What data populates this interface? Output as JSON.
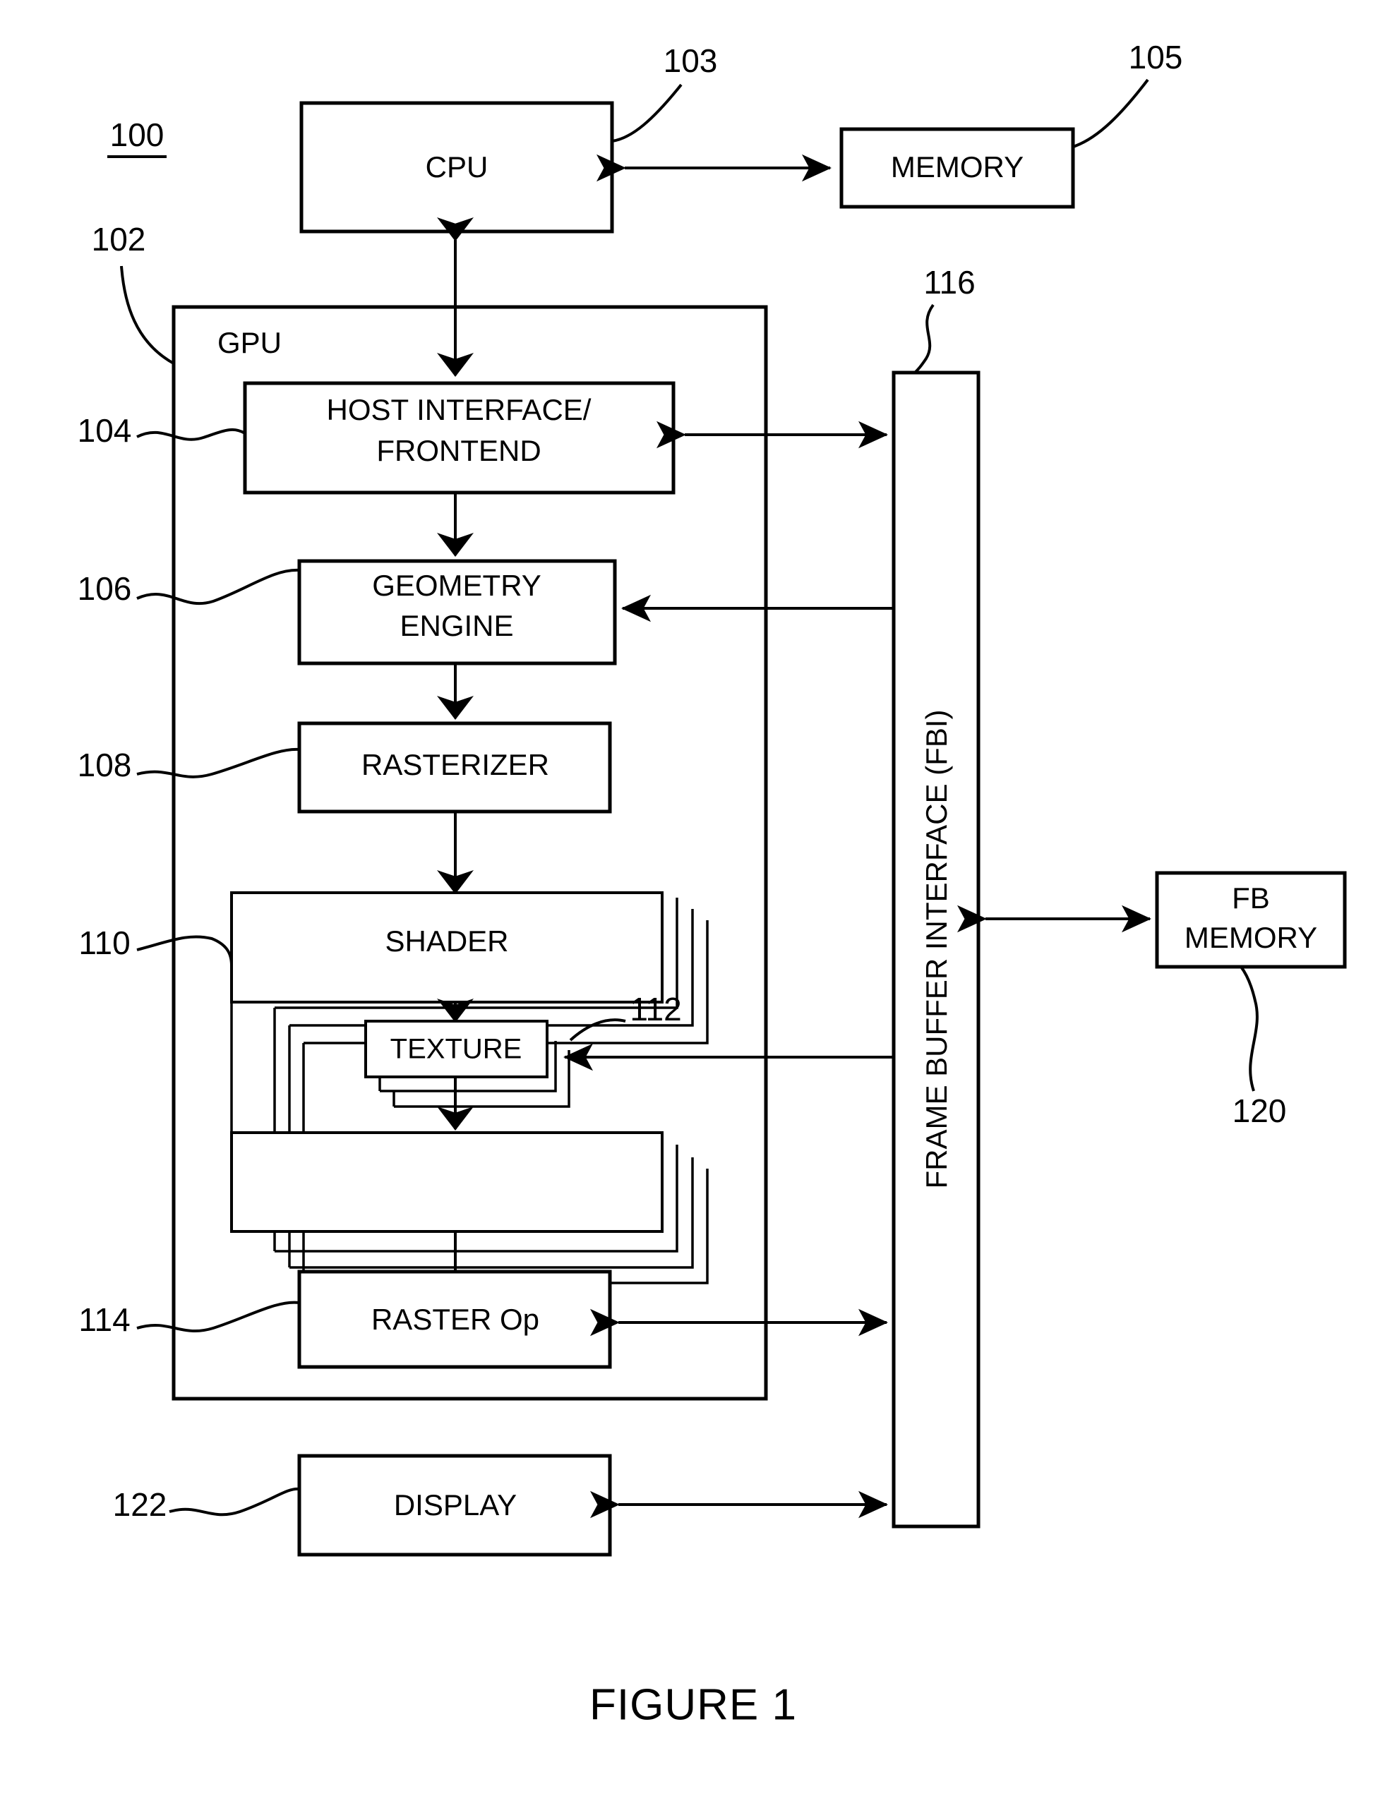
{
  "figure": {
    "caption": "FIGURE 1",
    "system_ref": "100"
  },
  "blocks": {
    "cpu": {
      "label": "CPU",
      "ref": "103"
    },
    "memory": {
      "label": "MEMORY",
      "ref": "105"
    },
    "gpu": {
      "label": "GPU",
      "ref": "102"
    },
    "host_interface": {
      "label_line1": "HOST INTERFACE/",
      "label_line2": "FRONTEND",
      "ref": "104"
    },
    "geometry_engine": {
      "label_line1": "GEOMETRY",
      "label_line2": "ENGINE",
      "ref": "106"
    },
    "rasterizer": {
      "label": "RASTERIZER",
      "ref": "108"
    },
    "shader": {
      "label": "SHADER",
      "ref": "110"
    },
    "texture": {
      "label": "TEXTURE",
      "ref": "112"
    },
    "raster_op": {
      "label": "RASTER Op",
      "ref": "114"
    },
    "fbi": {
      "label": "FRAME BUFFER INTERFACE (FBI)",
      "ref": "116"
    },
    "fb_memory": {
      "label_line1": "FB",
      "label_line2": "MEMORY",
      "ref": "120"
    },
    "display": {
      "label": "DISPLAY",
      "ref": "122"
    }
  },
  "colors": {
    "ink": "#000000",
    "paper": "#ffffff"
  }
}
